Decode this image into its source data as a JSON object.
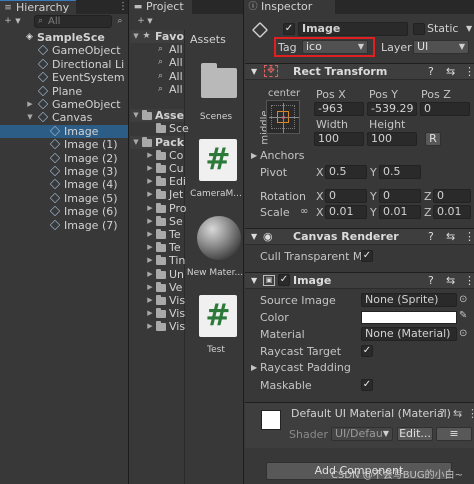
{
  "hierarchy": {
    "tab_label": "Hierarchy",
    "search_placeholder": "All",
    "items": [
      {
        "label": "SampleSce",
        "depth": 0,
        "arrow": "▼",
        "icon": "unity-scene-icon"
      },
      {
        "label": "GameObject",
        "depth": 1,
        "arrow": "",
        "icon": "cube-icon"
      },
      {
        "label": "Directional Li",
        "depth": 1,
        "arrow": "",
        "icon": "cube-icon"
      },
      {
        "label": "EventSystem",
        "depth": 1,
        "arrow": "",
        "icon": "cube-icon"
      },
      {
        "label": "Plane",
        "depth": 1,
        "arrow": "",
        "icon": "cube-icon"
      },
      {
        "label": "GameObject",
        "depth": 1,
        "arrow": "▶",
        "icon": "cube-icon"
      },
      {
        "label": "Canvas",
        "depth": 1,
        "arrow": "▼",
        "icon": "cube-icon"
      },
      {
        "label": "Image",
        "depth": 2,
        "arrow": "",
        "icon": "cube-icon",
        "selected": true
      },
      {
        "label": "Image (1)",
        "depth": 2,
        "arrow": "",
        "icon": "cube-icon"
      },
      {
        "label": "Image (2)",
        "depth": 2,
        "arrow": "",
        "icon": "cube-icon"
      },
      {
        "label": "Image (3)",
        "depth": 2,
        "arrow": "",
        "icon": "cube-icon"
      },
      {
        "label": "Image (4)",
        "depth": 2,
        "arrow": "",
        "icon": "cube-icon"
      },
      {
        "label": "Image (5)",
        "depth": 2,
        "arrow": "",
        "icon": "cube-icon"
      },
      {
        "label": "Image (6)",
        "depth": 2,
        "arrow": "",
        "icon": "cube-icon"
      },
      {
        "label": "Image (7)",
        "depth": 2,
        "arrow": "",
        "icon": "cube-icon"
      }
    ]
  },
  "project": {
    "tab_label": "Project",
    "tree": [
      {
        "label": "Favo",
        "arrow": "▼",
        "depth": 0,
        "icon": "star-icon",
        "bold": true
      },
      {
        "label": "All",
        "arrow": "",
        "depth": 1,
        "icon": "search-icon"
      },
      {
        "label": "All",
        "arrow": "",
        "depth": 1,
        "icon": "search-icon"
      },
      {
        "label": "All",
        "arrow": "",
        "depth": 1,
        "icon": "search-icon"
      },
      {
        "label": "All",
        "arrow": "",
        "depth": 1,
        "icon": "search-icon"
      },
      {
        "label": "",
        "arrow": "",
        "depth": 0,
        "icon": ""
      },
      {
        "label": "Asse",
        "arrow": "▼",
        "depth": 0,
        "icon": "folder-icon",
        "bold": true
      },
      {
        "label": "Sce",
        "arrow": "",
        "depth": 1,
        "icon": "folder-icon"
      },
      {
        "label": "Pack",
        "arrow": "▼",
        "depth": 0,
        "icon": "folder-icon",
        "bold": true
      },
      {
        "label": "Co",
        "arrow": "▶",
        "depth": 1,
        "icon": "folder-icon"
      },
      {
        "label": "Cu",
        "arrow": "▶",
        "depth": 1,
        "icon": "folder-icon"
      },
      {
        "label": "Edi",
        "arrow": "▶",
        "depth": 1,
        "icon": "folder-icon"
      },
      {
        "label": "Jet",
        "arrow": "▶",
        "depth": 1,
        "icon": "folder-icon"
      },
      {
        "label": "Pro",
        "arrow": "▶",
        "depth": 1,
        "icon": "folder-icon"
      },
      {
        "label": "Se",
        "arrow": "▶",
        "depth": 1,
        "icon": "folder-icon"
      },
      {
        "label": "Te",
        "arrow": "▶",
        "depth": 1,
        "icon": "folder-icon"
      },
      {
        "label": "Te",
        "arrow": "▶",
        "depth": 1,
        "icon": "folder-icon"
      },
      {
        "label": "Tin",
        "arrow": "▶",
        "depth": 1,
        "icon": "folder-icon"
      },
      {
        "label": "Un",
        "arrow": "▶",
        "depth": 1,
        "icon": "folder-icon"
      },
      {
        "label": "Ve",
        "arrow": "▶",
        "depth": 1,
        "icon": "folder-icon"
      },
      {
        "label": "Vis",
        "arrow": "▶",
        "depth": 1,
        "icon": "folder-icon"
      },
      {
        "label": "Vis",
        "arrow": "▶",
        "depth": 1,
        "icon": "folder-icon"
      },
      {
        "label": "Vis",
        "arrow": "▶",
        "depth": 1,
        "icon": "folder-icon"
      }
    ],
    "assets_header": "Assets",
    "assets": [
      {
        "label": "Scenes",
        "kind": "folder"
      },
      {
        "label": "CameraM...",
        "kind": "script"
      },
      {
        "label": "New Mater...",
        "kind": "material"
      },
      {
        "label": "Test",
        "kind": "script"
      }
    ],
    "script_glyph": "#"
  },
  "inspector": {
    "tab_label": "Inspector",
    "object_name": "Image",
    "static_label": "Static",
    "tag_label": "Tag",
    "tag_value": "ico",
    "layer_label": "Layer",
    "layer_value": "UI",
    "highlight_color": "#e02020",
    "rect_transform": {
      "title": "Rect Transform",
      "anchor_h": "center",
      "anchor_v": "middle",
      "pos_x_label": "Pos X",
      "pos_y_label": "Pos Y",
      "pos_z_label": "Pos Z",
      "pos_x": "-963",
      "pos_y": "-539.29",
      "pos_z": "0",
      "width_label": "Width",
      "height_label": "Height",
      "width": "100",
      "height": "100",
      "raw_edit": "R",
      "anchors_label": "Anchors",
      "pivot_label": "Pivot",
      "pivot_x": "0.5",
      "pivot_y": "0.5",
      "rotation_label": "Rotation",
      "rot_x": "0",
      "rot_y": "0",
      "rot_z": "0",
      "scale_label": "Scale",
      "scale_x": "0.01",
      "scale_y": "0.01",
      "scale_z": "0.01",
      "axis_x": "X",
      "axis_y": "Y",
      "axis_z": "Z"
    },
    "canvas_renderer": {
      "title": "Canvas Renderer",
      "cull_label": "Cull Transparent Me"
    },
    "image": {
      "title": "Image",
      "source_label": "Source Image",
      "source_value": "None (Sprite)",
      "color_label": "Color",
      "material_label": "Material",
      "material_value": "None (Material)",
      "raycast_label": "Raycast Target",
      "raycast_padding_label": "Raycast Padding",
      "maskable_label": "Maskable"
    },
    "material_panel": {
      "title": "Default UI Material (Material)",
      "shader_label": "Shader",
      "shader_value": "UI/Defau",
      "edit_label": "Edit...",
      "list_icon": "≡"
    },
    "add_component": "Add Component",
    "watermark": "CSDN @不会写BUG的小白~"
  }
}
